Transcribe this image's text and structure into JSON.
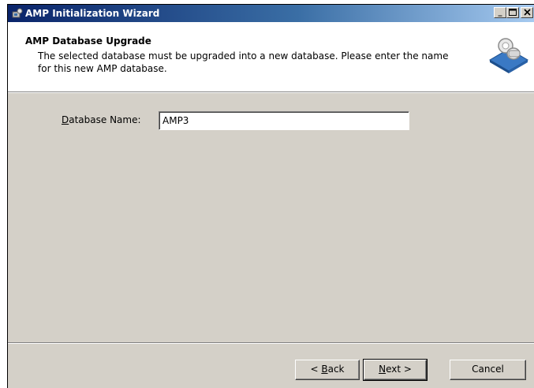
{
  "window": {
    "title": "AMP Initialization Wizard",
    "controls": [
      "minimize",
      "maximize",
      "close"
    ]
  },
  "header": {
    "title": "AMP Database Upgrade",
    "description": "The selected database must be upgraded into a new database.  Please enter the name for this new AMP database.",
    "art_icon": "database-key-icon"
  },
  "form": {
    "db_name_label_prefix": "D",
    "db_name_label_rest": "atabase Name:",
    "db_name_value": "AMP3"
  },
  "buttons": {
    "back_prefix": "< ",
    "back_accel": "B",
    "back_rest": "ack",
    "next_accel": "N",
    "next_rest": "ext >",
    "cancel": "Cancel"
  },
  "colors": {
    "face": "#d4d0c8",
    "title_start": "#0a246a",
    "title_end": "#a6caf0"
  }
}
